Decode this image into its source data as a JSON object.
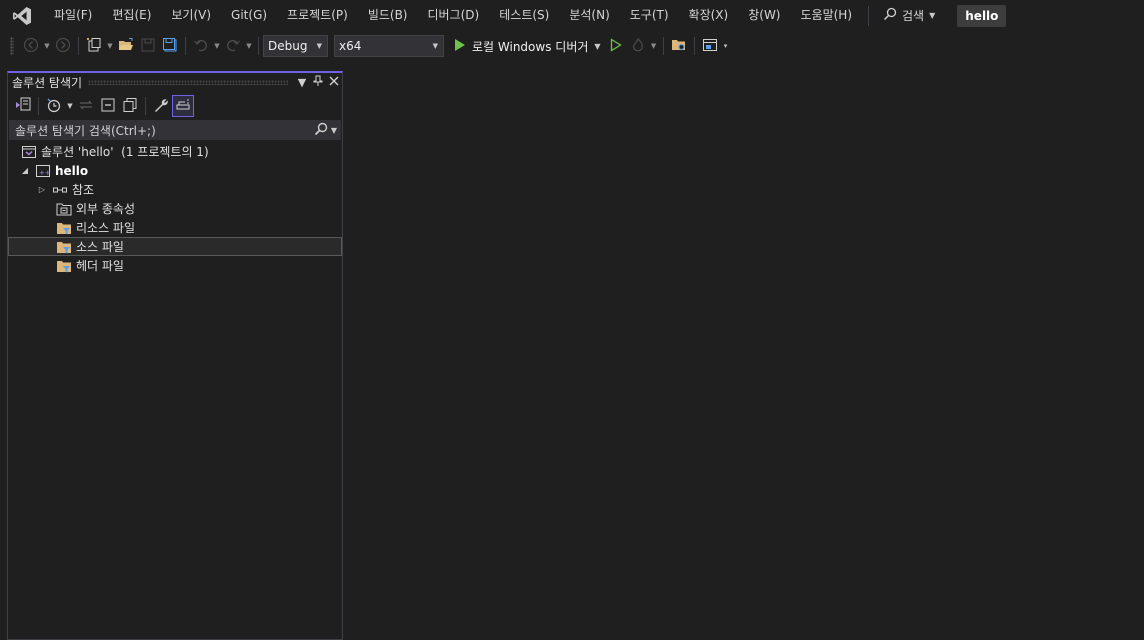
{
  "menu": {
    "items": [
      "파일(F)",
      "편집(E)",
      "보기(V)",
      "Git(G)",
      "프로젝트(P)",
      "빌드(B)",
      "디버그(D)",
      "테스트(S)",
      "분석(N)",
      "도구(T)",
      "확장(X)",
      "창(W)",
      "도움말(H)"
    ],
    "search_label": "검색",
    "solution_name": "hello"
  },
  "toolbar": {
    "configuration": "Debug",
    "platform": "x64",
    "run_label": "로컬 Windows 디버거"
  },
  "solution_explorer": {
    "title": "솔루션 탐색기",
    "search_placeholder": "솔루션 탐색기 검색(Ctrl+;)",
    "solution_label": "솔루션 'hello'  (1 프로젝트의 1)",
    "project_label": "hello",
    "nodes": [
      {
        "label": "참조",
        "icon": "references-icon"
      },
      {
        "label": "외부 종속성",
        "icon": "external-dependencies-icon"
      },
      {
        "label": "리소스 파일",
        "icon": "filter-folder-icon"
      },
      {
        "label": "소스 파일",
        "icon": "filter-folder-icon",
        "selected": true
      },
      {
        "label": "헤더 파일",
        "icon": "filter-folder-icon"
      }
    ]
  },
  "colors": {
    "background": "#1f1f1f",
    "accent": "#7160e8",
    "run_green": "#6cc24a"
  }
}
